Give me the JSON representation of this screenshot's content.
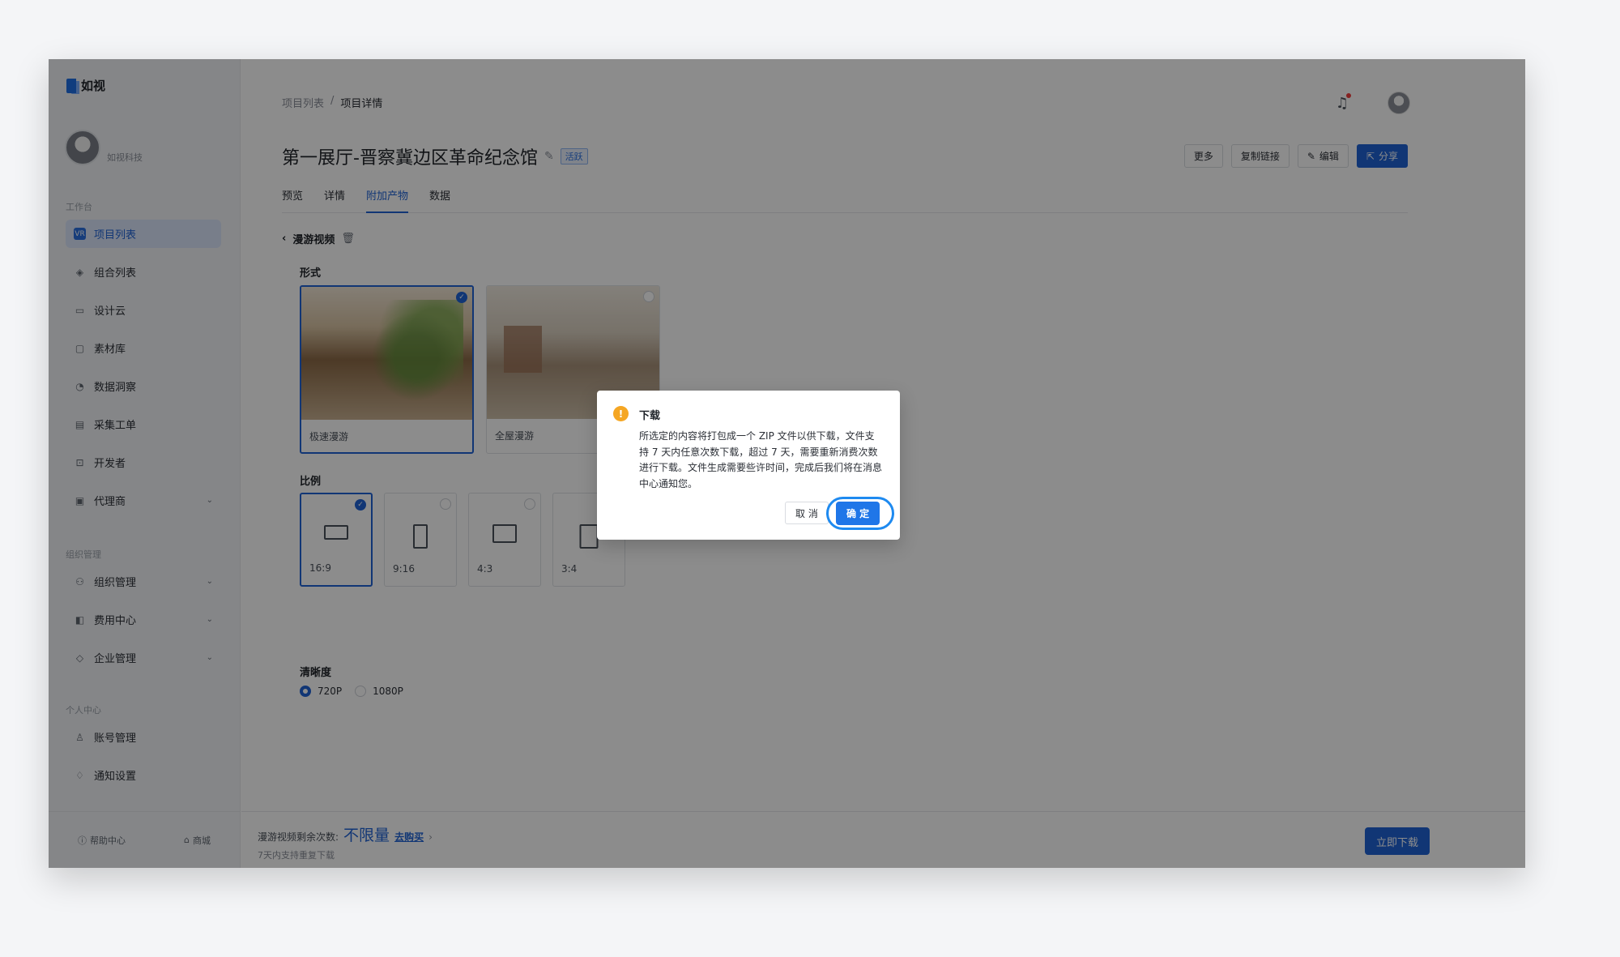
{
  "app": {
    "name": "如视"
  },
  "profile": {
    "name": "如视科技"
  },
  "sidebar": {
    "sections": [
      {
        "title": "工作台",
        "items": [
          {
            "label": "项目列表",
            "icon": "vr-icon",
            "active": true
          },
          {
            "label": "组合列表",
            "icon": "layers-icon"
          },
          {
            "label": "设计云",
            "icon": "design-icon"
          },
          {
            "label": "素材库",
            "icon": "folder-icon"
          },
          {
            "label": "数据洞察",
            "icon": "pie-icon"
          },
          {
            "label": "采集工单",
            "icon": "ticket-icon"
          },
          {
            "label": "开发者",
            "icon": "developer-icon"
          },
          {
            "label": "代理商",
            "icon": "briefcase-icon",
            "expandable": true
          }
        ]
      },
      {
        "title": "组织管理",
        "items": [
          {
            "label": "组织管理",
            "icon": "org-icon",
            "expandable": true
          },
          {
            "label": "费用中心",
            "icon": "wallet-icon",
            "expandable": true
          },
          {
            "label": "企业管理",
            "icon": "diamond-icon",
            "expandable": true
          }
        ]
      },
      {
        "title": "个人中心",
        "items": [
          {
            "label": "账号管理",
            "icon": "user-icon"
          },
          {
            "label": "通知设置",
            "icon": "bell-icon"
          }
        ]
      }
    ],
    "footer": {
      "help": "帮助中心",
      "store": "商城"
    }
  },
  "breadcrumb": {
    "parent": "项目列表",
    "separator": "/",
    "current": "项目详情"
  },
  "project": {
    "title": "第一展厅-晋察冀边区革命纪念馆",
    "status": "活跃"
  },
  "actions": {
    "more": "更多",
    "copy_link": "复制链接",
    "edit": "编辑",
    "share": "分享"
  },
  "tabs": [
    {
      "label": "预览"
    },
    {
      "label": "详情"
    },
    {
      "label": "附加产物",
      "active": true
    },
    {
      "label": "数据"
    }
  ],
  "video": {
    "section_title": "漫游视频",
    "form_label": "形式",
    "forms": [
      {
        "label": "极速漫游",
        "selected": true
      },
      {
        "label": "全屋漫游",
        "selected": false
      }
    ],
    "ratio_label": "比例",
    "ratios": [
      {
        "label": "16:9",
        "selected": true
      },
      {
        "label": "9:16",
        "selected": false
      },
      {
        "label": "4:3",
        "selected": false
      },
      {
        "label": "3:4",
        "selected": false
      }
    ],
    "resolution_label": "清晰度",
    "resolutions": [
      {
        "label": "720P",
        "selected": true
      },
      {
        "label": "1080P",
        "selected": false
      }
    ]
  },
  "bottom": {
    "quota_label": "漫游视频剩余次数:",
    "quota_value": "不限量",
    "buy_link": "去购买",
    "note": "7天内支持重复下载",
    "download": "立即下载"
  },
  "dialog": {
    "title": "下载",
    "body": "所选定的内容将打包成一个 ZIP 文件以供下载，文件支持 7 天内任意次数下载，超过 7 天，需要重新消费次数进行下载。文件生成需要些许时间，完成后我们将在消息中心通知您。",
    "cancel": "取 消",
    "confirm": "确 定"
  },
  "colors": {
    "primary": "#1f63d6",
    "warning": "#f5a623",
    "focus_ring": "#1e8af0"
  }
}
